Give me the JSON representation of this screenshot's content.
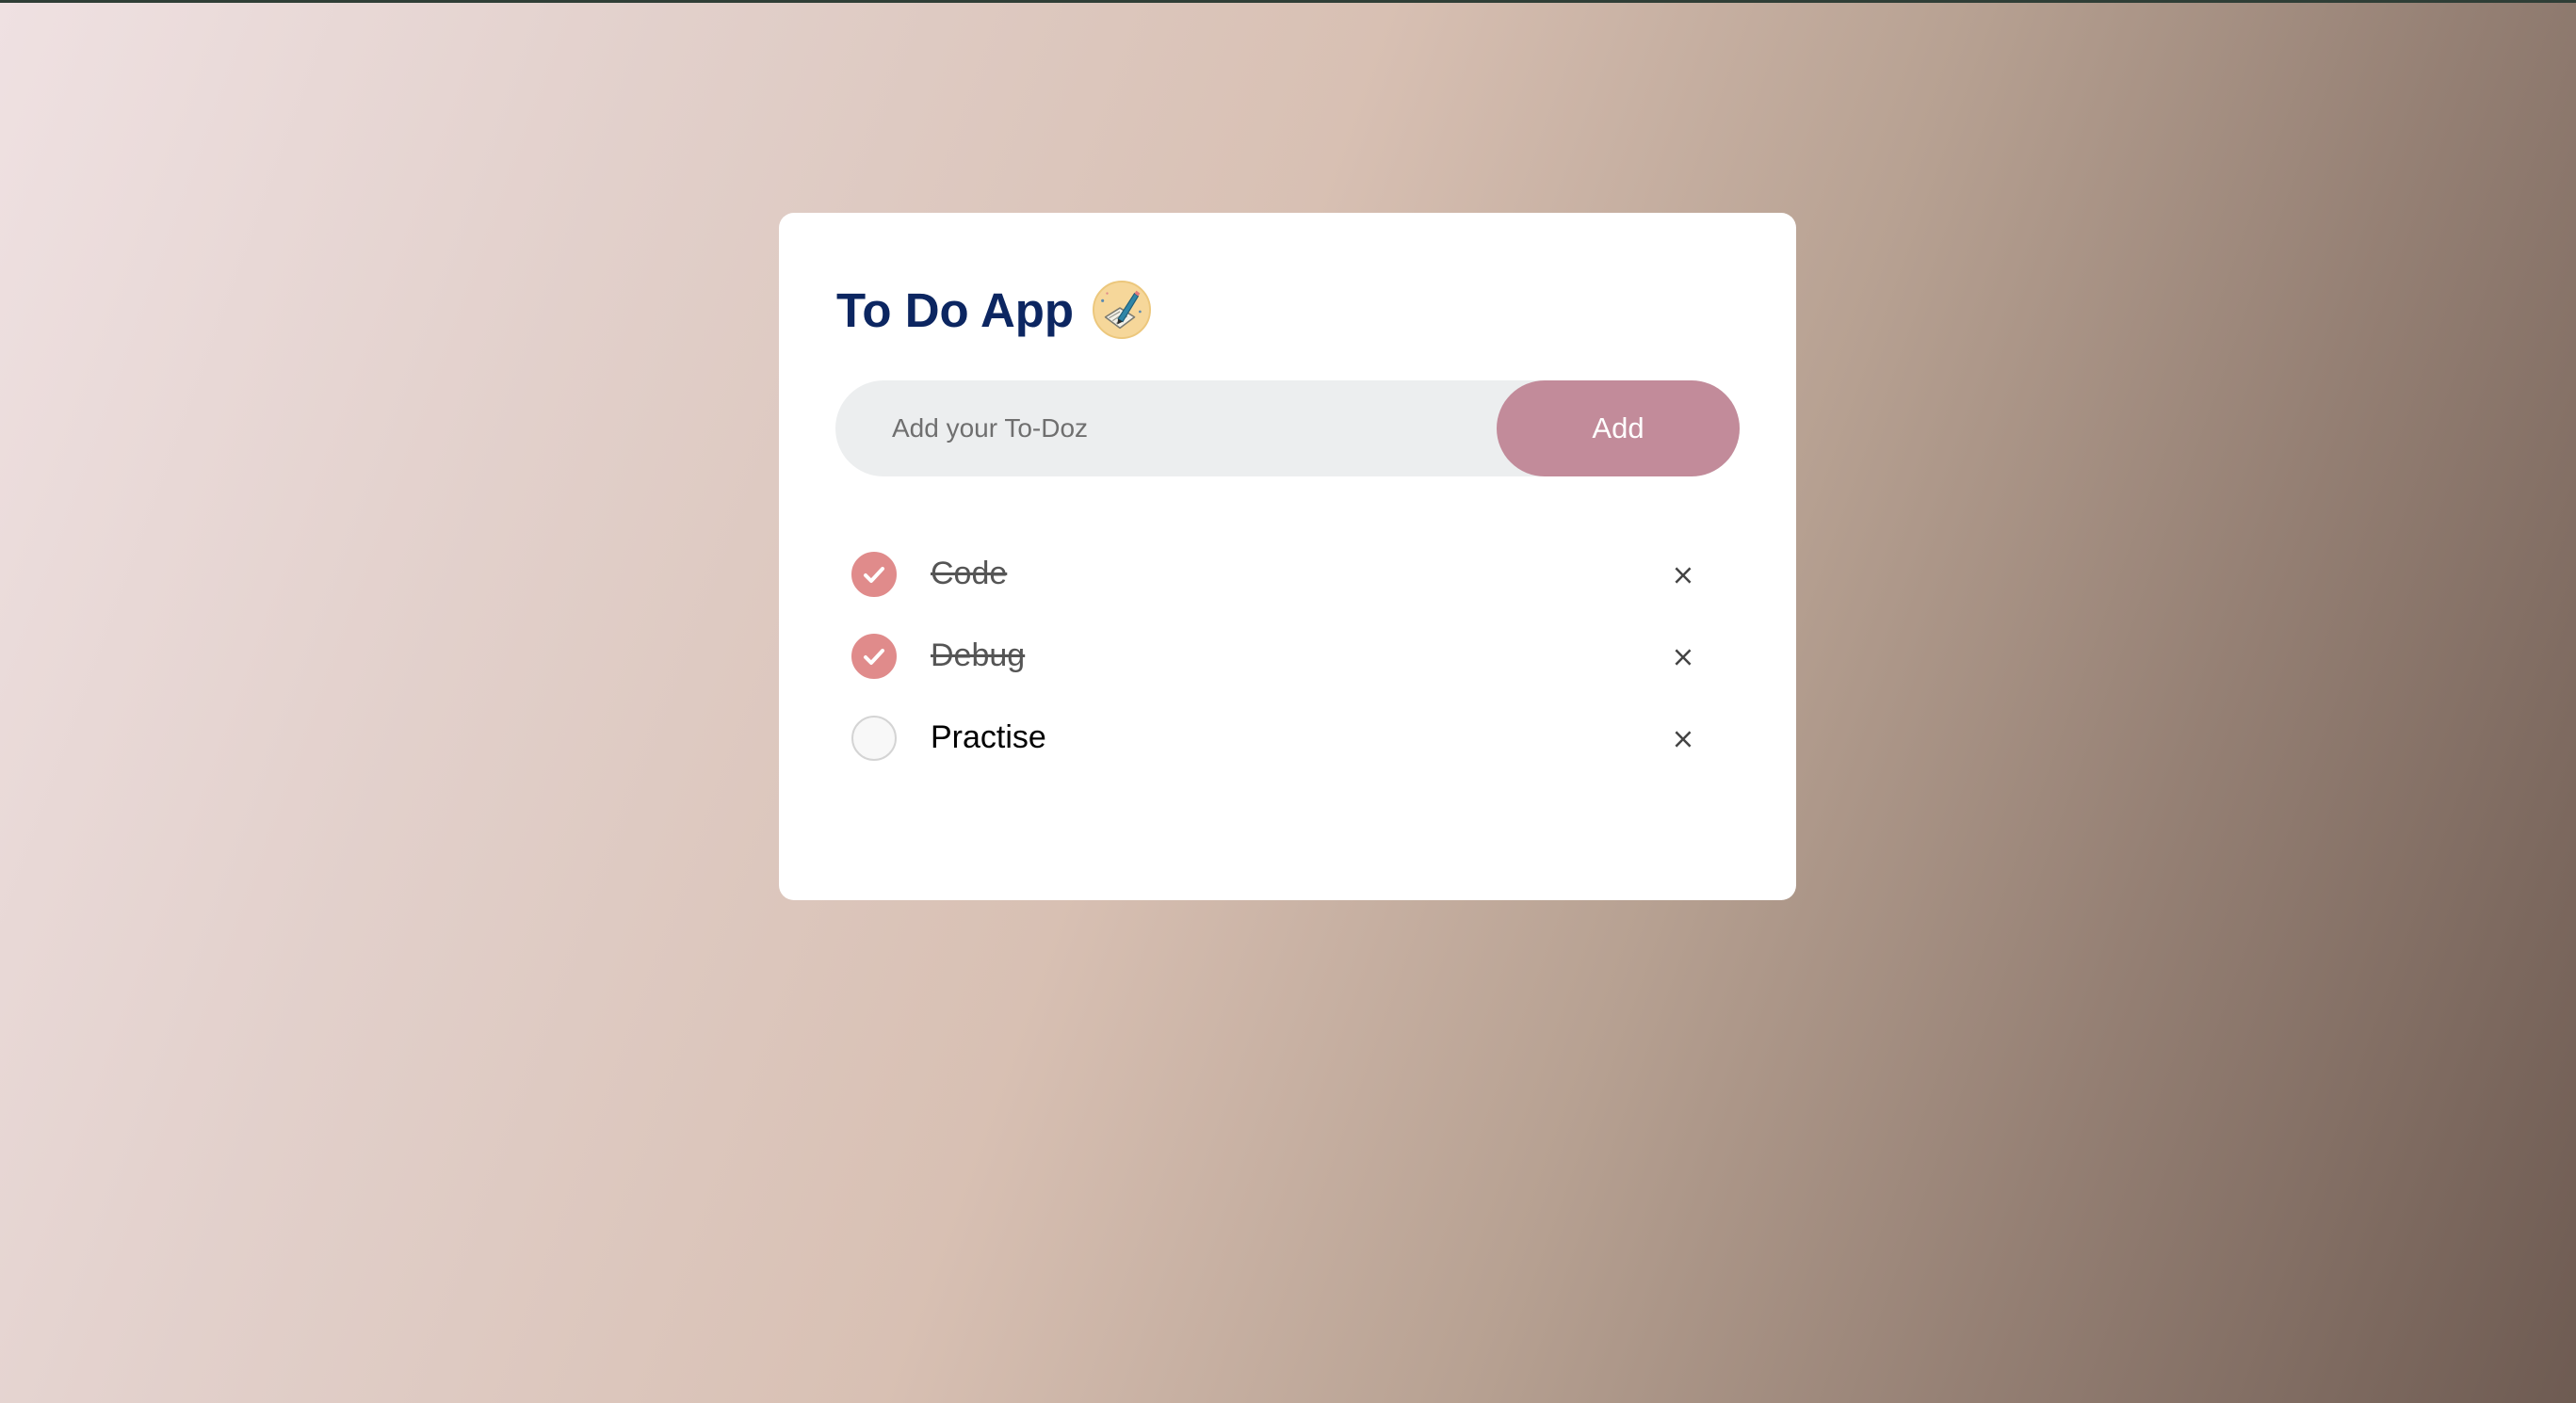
{
  "app": {
    "title": "To Do App",
    "title_icon": "pencil-notepad-icon"
  },
  "input": {
    "placeholder": "Add your To-Doz",
    "value": "",
    "add_label": "Add"
  },
  "todos": [
    {
      "label": "Code",
      "done": true
    },
    {
      "label": "Debug",
      "done": true
    },
    {
      "label": "Practise",
      "done": false
    }
  ],
  "remove_glyph": "×",
  "colors": {
    "title": "#0c2661",
    "accent": "#c28b9a",
    "check_done": "#e08b8b",
    "input_bg": "#eceeef"
  }
}
